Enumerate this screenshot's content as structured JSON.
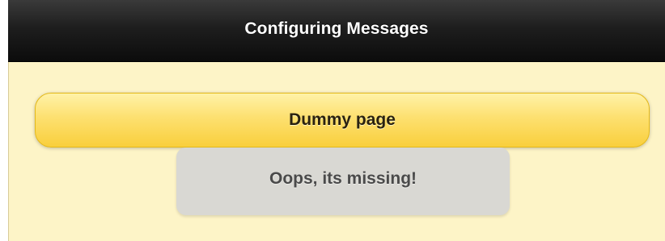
{
  "header": {
    "title": "Configuring Messages"
  },
  "main": {
    "button_label": "Dummy page"
  },
  "message": {
    "text": "Oops, its missing!"
  },
  "colors": {
    "header_bg": "#1e1e1e",
    "content_bg": "#fdf4c7",
    "button_bg": "#fde070",
    "message_bg": "#d9d8d3"
  }
}
